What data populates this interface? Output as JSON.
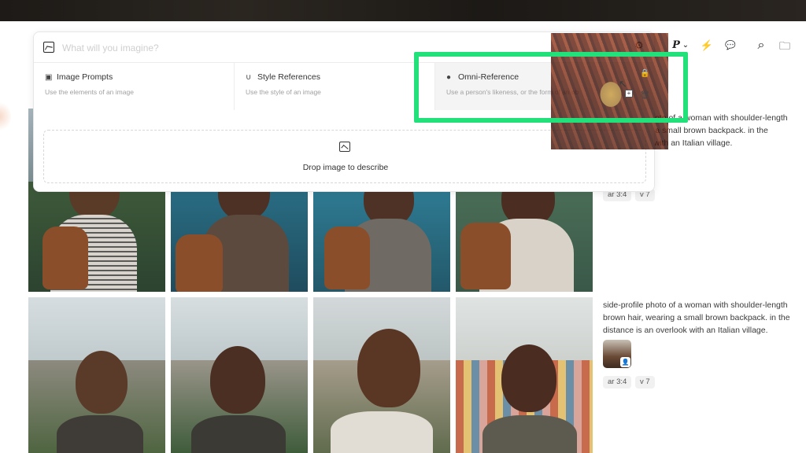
{
  "search": {
    "placeholder": "What will you imagine?",
    "icon": "image-icon"
  },
  "references": [
    {
      "title": "Image Prompts",
      "description": "Use the elements of an image",
      "icon": "image-icon"
    },
    {
      "title": "Style References",
      "description": "Use the style of an image",
      "icon": "paperclip-icon"
    },
    {
      "title": "Omni-Reference",
      "description": "Use a person's likeness, or the form of an ob",
      "icon": "person-icon"
    }
  ],
  "drop": {
    "label": "Drop image to describe",
    "icon": "image-icon"
  },
  "toolbar": {
    "settings_icon": "⚙",
    "personalize_label": "P",
    "personalize_caret": "⌄",
    "speed_icon": "⚡",
    "chat_icon": "💬",
    "search_icon": "⌕",
    "folder_icon": "🗀"
  },
  "results": [
    {
      "prompt": "side-profile photo of a woman with shoulder-length brown hair, wearing a small brown backpack. in the distance is an overlook with an Italian village.",
      "visible_prompt_lines": [
        "side-profile photo of a woman with shoulder-length",
        "aring a small brown backpack. in the",
        "overlook with an Italian village."
      ],
      "tags": [
        "ar 3:4",
        "v 7"
      ]
    },
    {
      "prompt_lines": [
        "side-profile photo of a woman with shoulder-length",
        "brown hair, wearing a small brown backpack. in the",
        "distance is an overlook with an Italian village."
      ],
      "tags": [
        "ar 3:4",
        "v 7"
      ],
      "reference_badge": "person-icon"
    }
  ],
  "overlay": {
    "lock_icon": "🔒",
    "trash_icon": "🗑",
    "cursor_icon": "↖",
    "plus_icon": "+"
  },
  "colors": {
    "highlight": "#22e07a",
    "panel_bg": "#ffffff",
    "selected_ref_bg": "#f4f4f4"
  }
}
